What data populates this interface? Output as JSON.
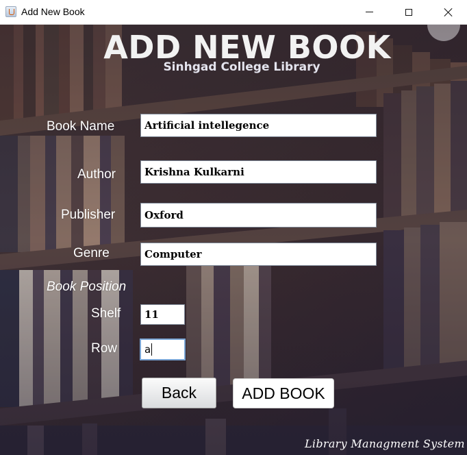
{
  "window": {
    "title": "Add New Book"
  },
  "header": {
    "title": "ADD NEW BOOK",
    "subtitle": "Sinhgad College Library"
  },
  "form": {
    "book_name": {
      "label": "Book Name",
      "value": "Artificial intellegence"
    },
    "author": {
      "label": "Author",
      "value": "Krishna Kulkarni"
    },
    "publisher": {
      "label": "Publisher",
      "value": "Oxford"
    },
    "genre": {
      "label": "Genre",
      "value": "Computer"
    },
    "position_heading": "Book Position",
    "shelf": {
      "label": "Shelf",
      "value": "11"
    },
    "row": {
      "label": "Row",
      "value": "a"
    }
  },
  "buttons": {
    "back": "Back",
    "add_book": "ADD BOOK"
  },
  "footer": {
    "text": "Library Managment System"
  },
  "icons": {
    "app": "java-coffee-cup-icon",
    "minimize": "minimize-icon",
    "maximize": "maximize-icon",
    "close": "close-icon"
  }
}
